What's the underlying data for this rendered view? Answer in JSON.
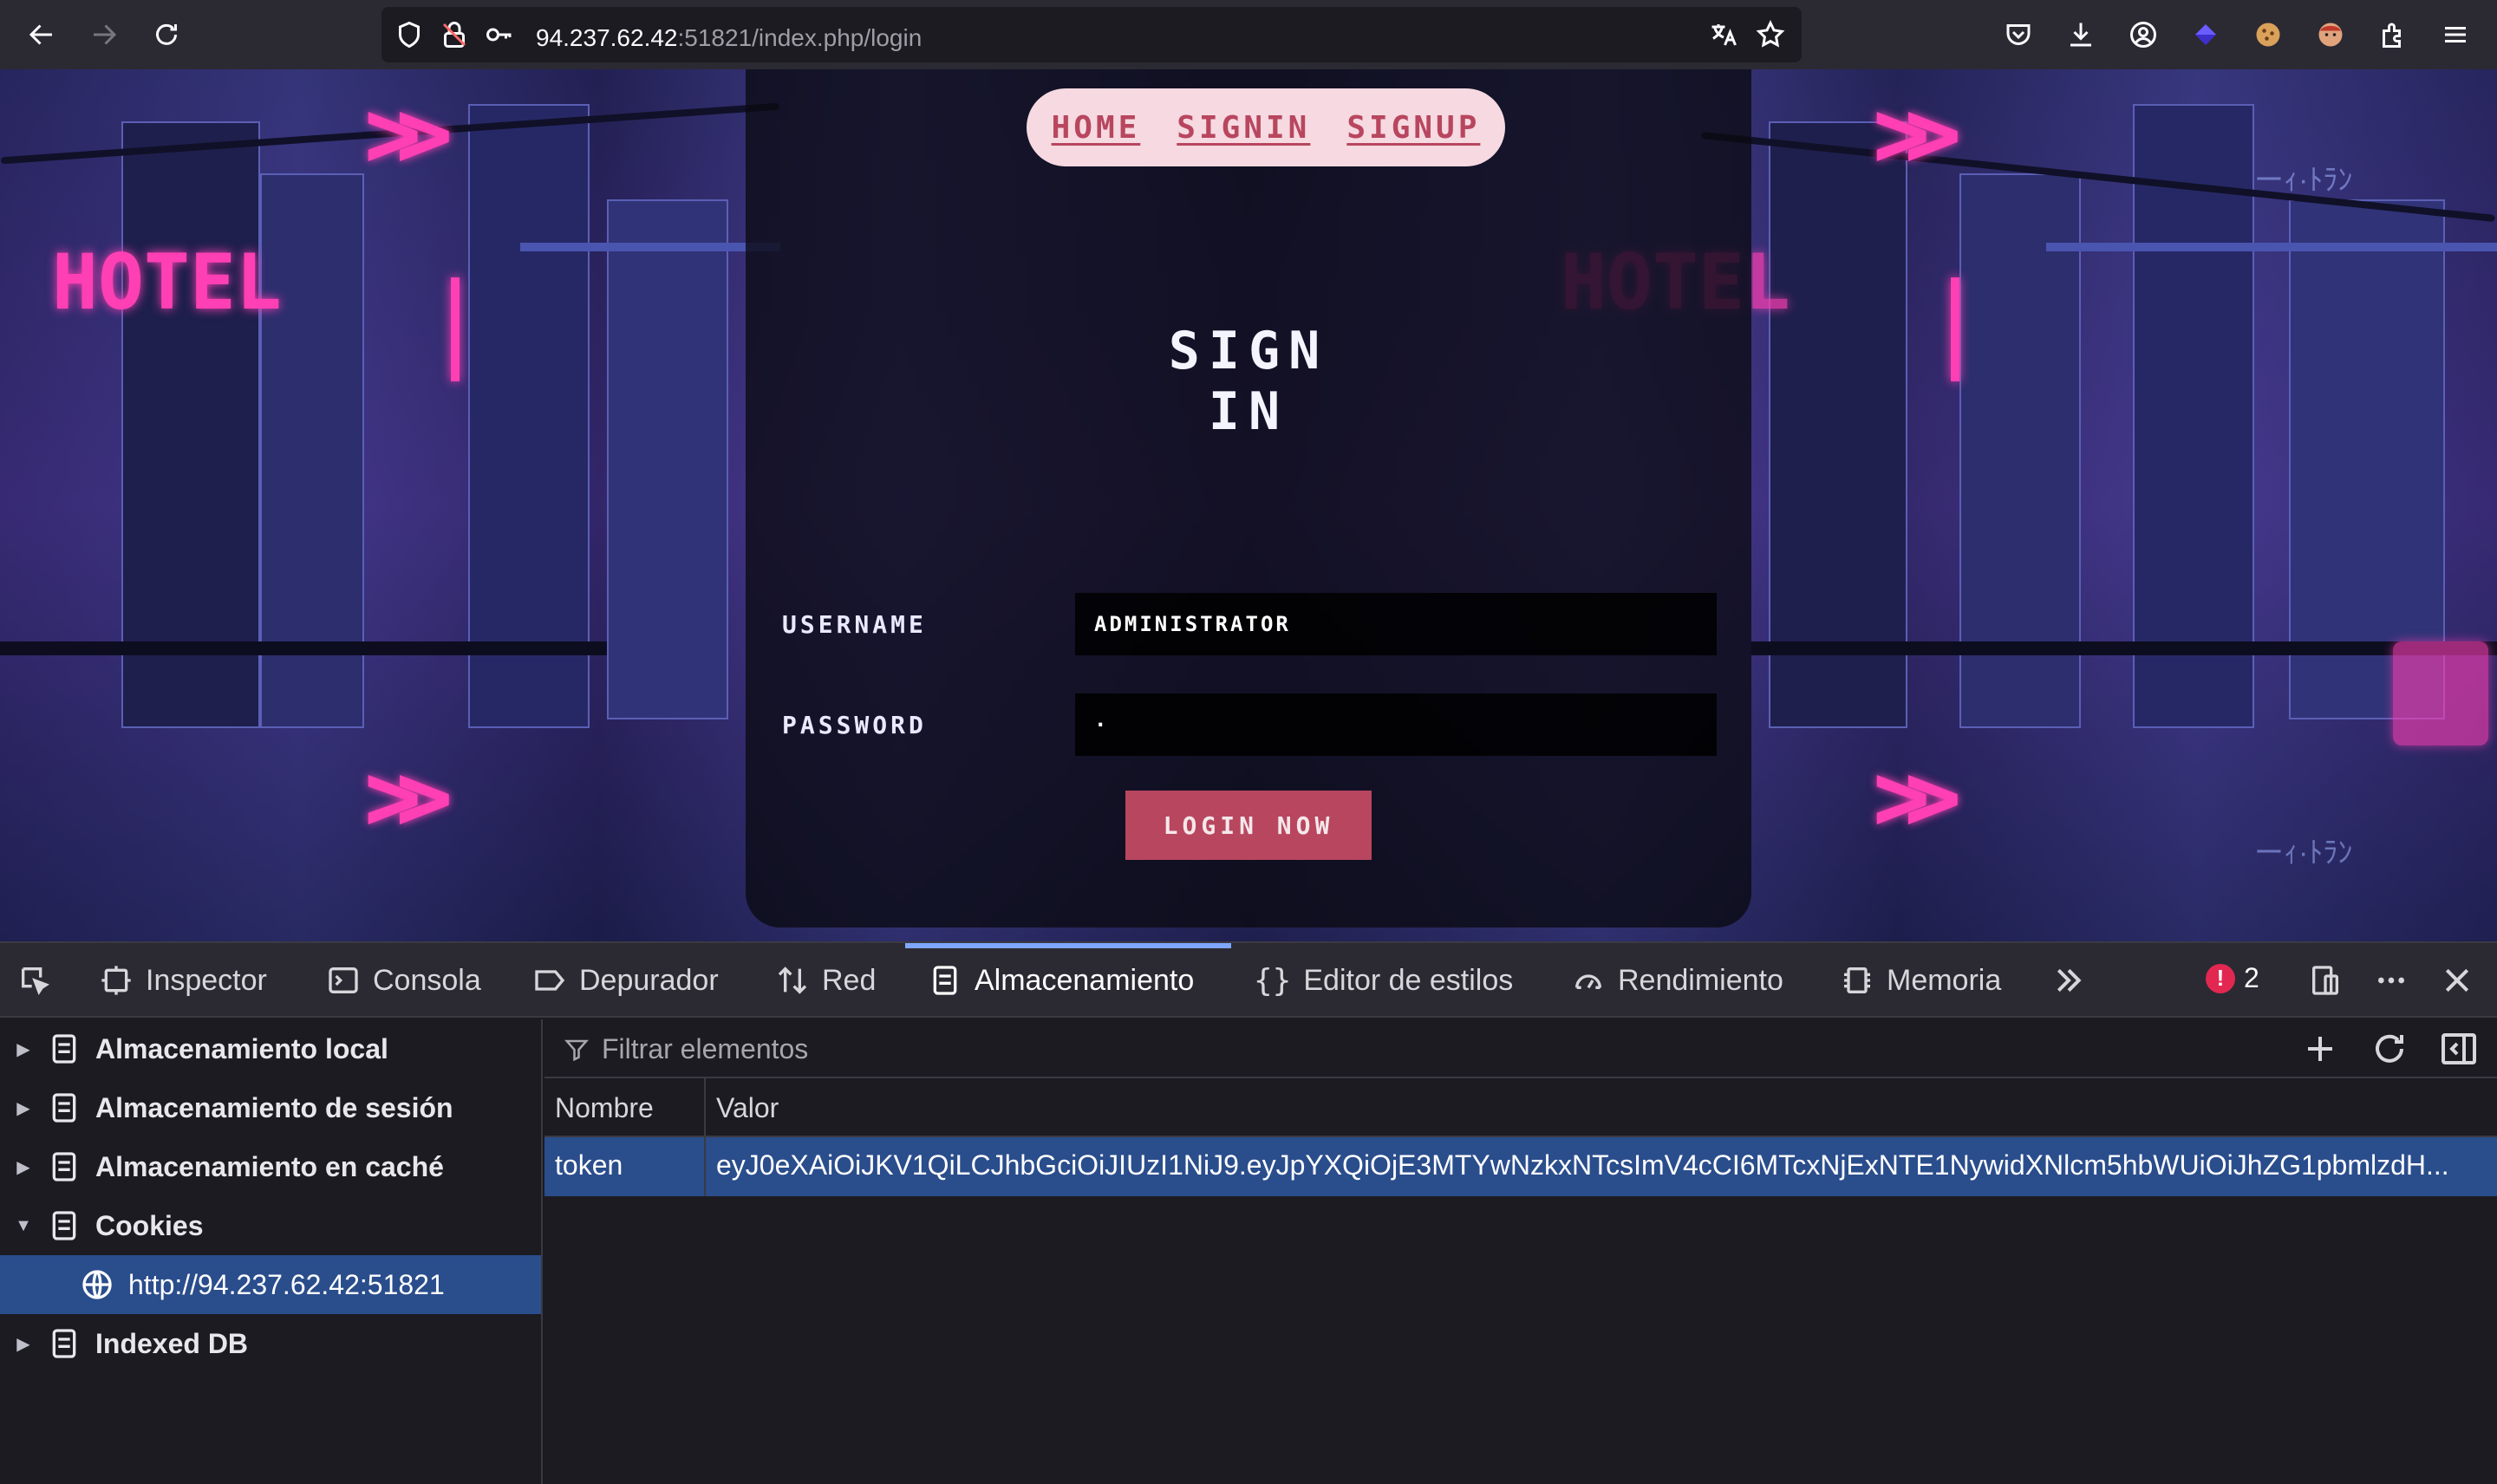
{
  "browser": {
    "url_host": "94.237.62.42",
    "url_rest": ":51821/index.php/login",
    "icons": {
      "back": "back-arrow-icon",
      "forward": "forward-arrow-icon",
      "reload": "reload-icon",
      "tracking": "shield-icon",
      "insecure": "insecure-lock-icon",
      "permissions": "key-icon",
      "translate": "translate-icon",
      "bookmark": "star-icon",
      "pocket": "pocket-icon",
      "downloads": "download-icon",
      "account": "account-icon",
      "extensions": "extensions-icon",
      "menu": "hamburger-menu-icon"
    }
  },
  "page": {
    "nav": {
      "home": "HOME",
      "signin": "SIGNIN",
      "signup": "SIGNUP"
    },
    "title": "SIGN IN",
    "username_label": "USERNAME",
    "username_value": "ADMINISTRATOR",
    "password_label": "PASSWORD",
    "password_value": "·",
    "login_button": "LOGIN NOW",
    "bg_sign": "HOTEL",
    "bg_jp": "ーｨ·ﾄﾗﾝ",
    "colors": {
      "accent": "#b8465f",
      "nav_bg": "#f6d9e1",
      "neon": "#ff3fb4"
    }
  },
  "devtools": {
    "tabs": {
      "inspector": "Inspector",
      "console": "Consola",
      "debugger": "Depurador",
      "network": "Red",
      "storage": "Almacenamiento",
      "style_editor": "Editor de estilos",
      "performance": "Rendimiento",
      "memory": "Memoria"
    },
    "error_count": "2",
    "sidebar": {
      "local": "Almacenamiento local",
      "session": "Almacenamiento de sesión",
      "cache": "Almacenamiento en caché",
      "cookies": "Cookies",
      "cookie_host": "http://94.237.62.42:51821",
      "indexeddb": "Indexed DB"
    },
    "filter_placeholder": "Filtrar elementos",
    "table": {
      "columns": [
        "Nombre",
        "Valor"
      ],
      "rows": [
        {
          "name": "token",
          "value": "eyJ0eXAiOiJKV1QiLCJhbGciOiJIUzI1NiJ9.eyJpYXQiOjE3MTYwNzkxNTcsImV4cCI6MTcxNjExNTE1NywidXNlcm5hbWUiOiJhZG1pbmlzdH..."
        }
      ]
    }
  }
}
